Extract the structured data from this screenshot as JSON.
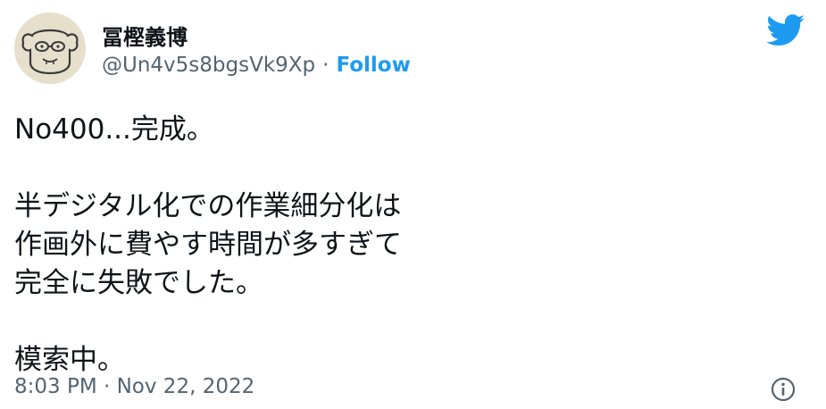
{
  "tweet": {
    "author": {
      "display_name": "冨樫義博",
      "handle": "@Un4v5s8bgsVk9Xp",
      "separator": "·",
      "follow_label": "Follow"
    },
    "text_lines": {
      "l1": "No400...完成。",
      "l2": "半デジタル化での作業細分化は",
      "l3": "作画外に費やす時間が多すぎて",
      "l4": "完全に失敗でした。",
      "l5": "模索中。"
    },
    "timestamp": "8:03 PM · Nov 22, 2022"
  },
  "colors": {
    "accent": "#1d9bf0",
    "secondary_text": "#536471",
    "primary_text": "#0f1419"
  },
  "icons": {
    "brand": "twitter-bird-icon",
    "info": "info-icon",
    "avatar": "cartoon-face-avatar"
  }
}
